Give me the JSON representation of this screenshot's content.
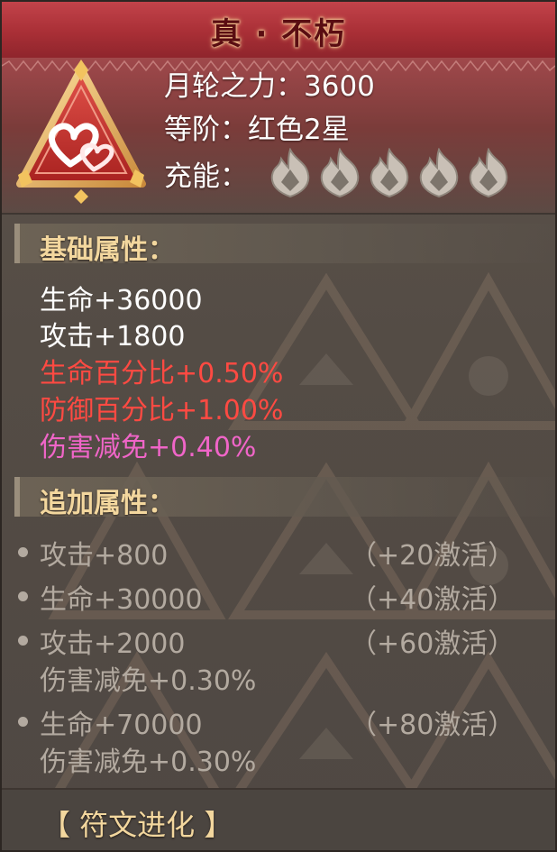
{
  "title": "真 · 不朽",
  "header": {
    "moon_power": "月轮之力：3600",
    "rank": "等阶：红色2星",
    "charge_label": "充能："
  },
  "base_section": {
    "label": "基础属性：",
    "lines": [
      {
        "text": "生命+36000",
        "color": "white"
      },
      {
        "text": "攻击+1800",
        "color": "white"
      },
      {
        "text": "生命百分比+0.50%",
        "color": "red"
      },
      {
        "text": "防御百分比+1.00%",
        "color": "red"
      },
      {
        "text": "伤害减免+0.40%",
        "color": "pink"
      }
    ]
  },
  "extra_section": {
    "label": "追加属性：",
    "items": [
      {
        "line1": "攻击+800",
        "line2": "",
        "activate": "（+20激活）"
      },
      {
        "line1": "生命+30000",
        "line2": "",
        "activate": "（+40激活）"
      },
      {
        "line1": "攻击+2000",
        "line2": "伤害减免+0.30%",
        "activate": "（+60激活）"
      },
      {
        "line1": "生命+70000",
        "line2": "伤害减免+0.30%",
        "activate": "（+80激活）"
      }
    ]
  },
  "footer": {
    "evolve_label": "【 符文进化 】"
  },
  "colors": {
    "title_bar": "#a92f36",
    "section_label": "#f3d79e",
    "red_stat": "#ff4a42",
    "pink_stat": "#f065c8",
    "inactive_text": "#b3aaa0"
  },
  "icons": [
    "heart-rune-icon",
    "flame-charge-icon"
  ]
}
